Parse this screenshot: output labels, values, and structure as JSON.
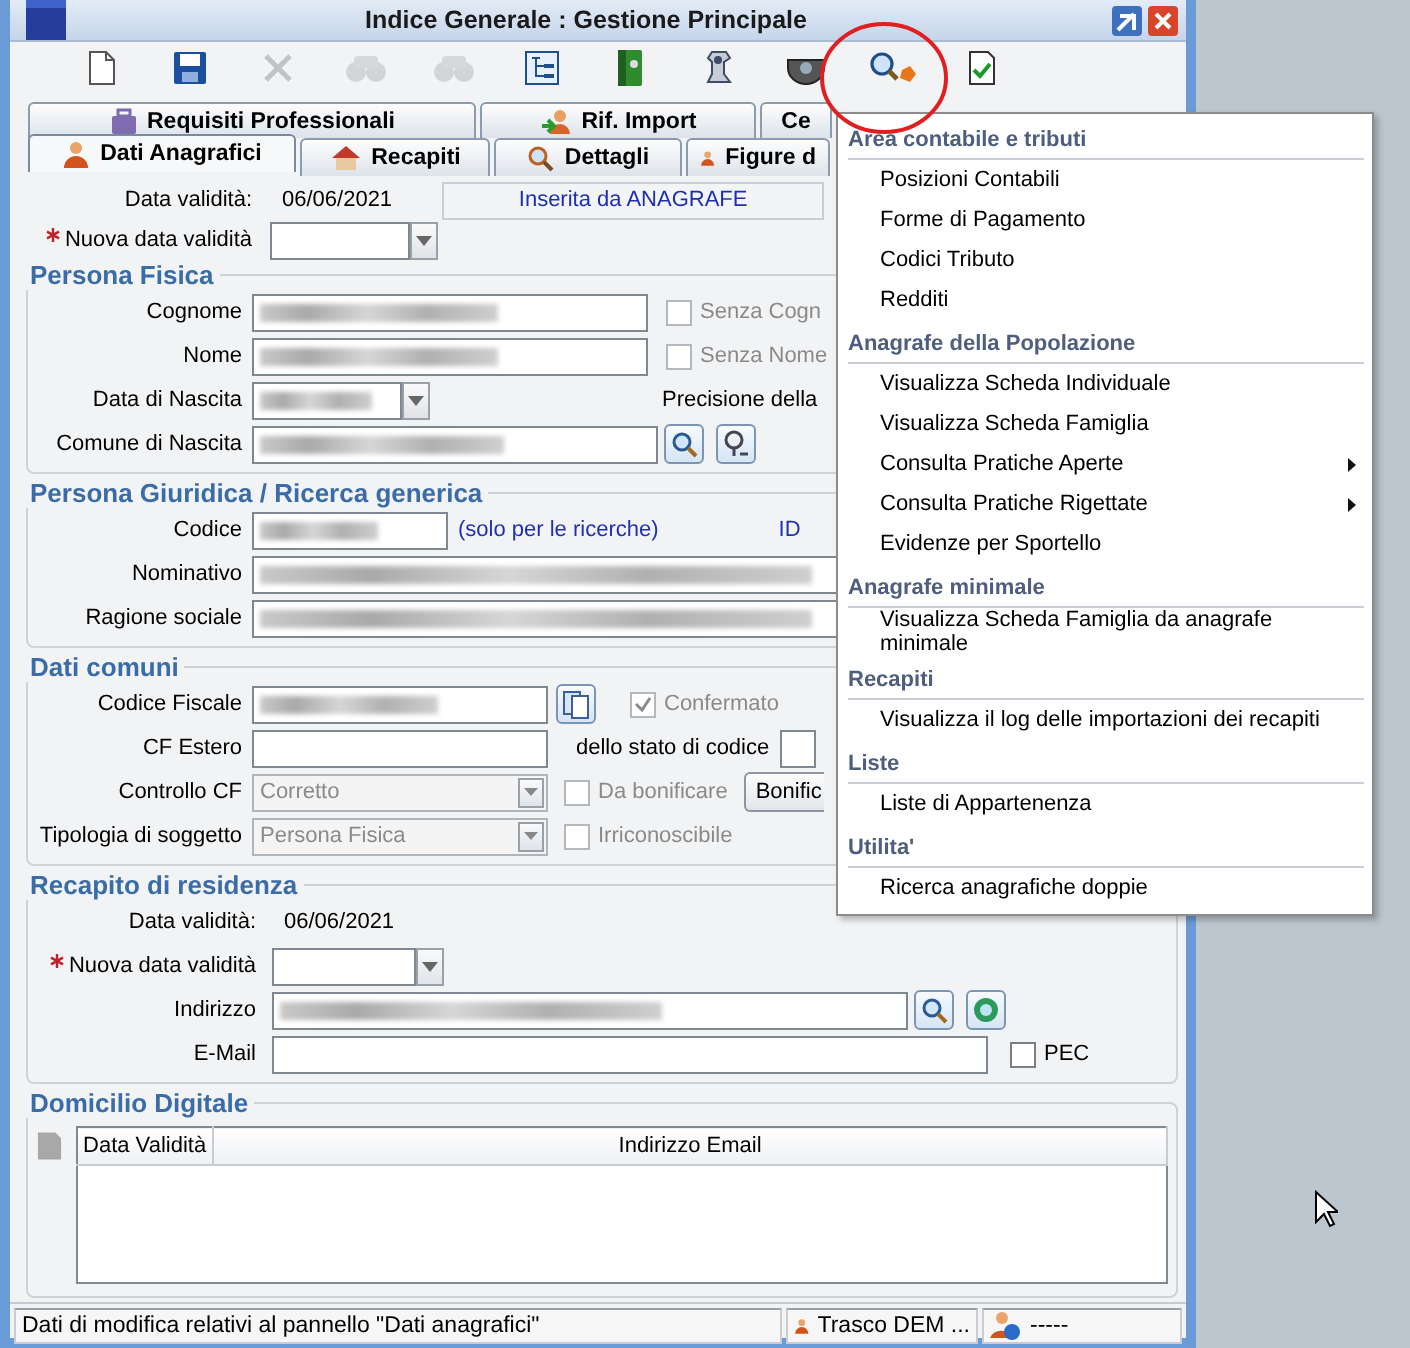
{
  "window": {
    "title": "Indice Generale : Gestione Principale"
  },
  "toolbar": [
    {
      "kind": "new",
      "disabled": false
    },
    {
      "kind": "save",
      "disabled": false
    },
    {
      "kind": "delete",
      "disabled": true
    },
    {
      "kind": "binoculars",
      "disabled": true
    },
    {
      "kind": "binoculars",
      "disabled": true
    },
    {
      "kind": "tree",
      "disabled": false
    },
    {
      "kind": "folder",
      "disabled": false
    },
    {
      "kind": "stamp",
      "disabled": false
    },
    {
      "kind": "camera",
      "disabled": false
    },
    {
      "kind": "search",
      "disabled": false
    },
    {
      "kind": "check",
      "disabled": false
    }
  ],
  "tabs": [
    [
      {
        "label": "Requisiti Professionali",
        "selected": false
      },
      {
        "label": "Rif. Import",
        "selected": false
      },
      {
        "label": "Ce",
        "selected": false
      }
    ],
    [
      {
        "label": "Dati Anagrafici",
        "selected": true
      },
      {
        "label": "Recapiti",
        "selected": false
      },
      {
        "label": "Dettagli",
        "selected": false
      },
      {
        "label": "Figure d",
        "selected": false
      }
    ]
  ],
  "form": {
    "header": {
      "validity_label": "Data validità:",
      "validity_value": "06/06/2021",
      "source": "Inserita da ANAGRAFE",
      "new_validity": {
        "label": "Nuova data validità",
        "required": true
      }
    },
    "sections": [
      {
        "title": "Persona Fisica",
        "rows": [
          {
            "label": "Cognome",
            "field": {
              "kind": "text",
              "redacted": true
            },
            "extras": [
              {
                "kind": "checkbox",
                "label": "Senza Cogn",
                "checked": false,
                "disabled": true
              }
            ]
          },
          {
            "label": "Nome",
            "field": {
              "kind": "text",
              "redacted": true
            },
            "extras": [
              {
                "kind": "checkbox",
                "label": "Senza Nome",
                "checked": false,
                "disabled": true
              }
            ]
          },
          {
            "label": "Data di Nascita",
            "field": {
              "kind": "date",
              "redacted": true
            },
            "extras": [
              {
                "kind": "label",
                "label": "Precisione della"
              }
            ]
          },
          {
            "label": "Comune di Nascita",
            "field": {
              "kind": "text",
              "redacted": true
            },
            "extras": [
              {
                "kind": "search-button"
              },
              {
                "kind": "pin-button"
              }
            ]
          }
        ]
      },
      {
        "title": "Persona Giuridica / Ricerca generica",
        "rows": [
          {
            "label": "Codice",
            "field": {
              "kind": "text",
              "redacted": true
            },
            "extras": [
              {
                "kind": "note",
                "label": "(solo per le ricerche)"
              },
              {
                "kind": "note",
                "label": "ID"
              }
            ]
          },
          {
            "label": "Nominativo",
            "field": {
              "kind": "text",
              "redacted": true
            },
            "extras": []
          },
          {
            "label": "Ragione sociale",
            "field": {
              "kind": "text",
              "redacted": true
            },
            "extras": []
          }
        ]
      },
      {
        "title": "Dati comuni",
        "rows": [
          {
            "label": "Codice Fiscale",
            "field": {
              "kind": "text",
              "redacted": true
            },
            "extras": [
              {
                "kind": "copy-button"
              },
              {
                "kind": "checkbox",
                "label": "Confermato",
                "checked": true,
                "disabled": true
              }
            ]
          },
          {
            "label": "CF Estero",
            "field": {
              "kind": "text",
              "redacted": false
            },
            "extras": [
              {
                "kind": "label",
                "label": "dello stato di codice"
              },
              {
                "kind": "field"
              }
            ]
          },
          {
            "label": "Controllo CF",
            "field": {
              "kind": "select",
              "value": "Corretto",
              "disabled": true
            },
            "extras": [
              {
                "kind": "checkbox",
                "label": "Da bonificare",
                "checked": false,
                "disabled": true
              },
              {
                "kind": "button",
                "label": "Bonific"
              }
            ]
          },
          {
            "label": "Tipologia di soggetto",
            "field": {
              "kind": "select",
              "value": "Persona Fisica",
              "disabled": true
            },
            "extras": [
              {
                "kind": "checkbox",
                "label": "Irriconoscibile",
                "checked": false,
                "disabled": true
              }
            ]
          }
        ]
      },
      {
        "title": "Recapito di residenza",
        "rows": [
          {
            "label": "Data validità:",
            "field": {
              "kind": "value",
              "value": "06/06/2021"
            },
            "extras": []
          },
          {
            "label": "Nuova data validità",
            "required": true,
            "field": {
              "kind": "date",
              "redacted": false
            },
            "extras": []
          },
          {
            "label": "Indirizzo",
            "field": {
              "kind": "text",
              "redacted": true
            },
            "extras": [
              {
                "kind": "search-button"
              },
              {
                "kind": "globe-button"
              }
            ]
          },
          {
            "label": "E-Mail",
            "field": {
              "kind": "text",
              "redacted": false
            },
            "extras": [
              {
                "kind": "checkbox",
                "label": "PEC",
                "checked": false,
                "disabled": false
              }
            ]
          }
        ]
      }
    ],
    "digital_domicile": {
      "title": "Domicilio Digitale",
      "columns": [
        "Data Validità",
        "Indirizzo Email"
      ]
    }
  },
  "status_bar": {
    "message": "Dati di modifica relativi al pannello \"Dati anagrafici\"",
    "user": "Trasco DEM ...",
    "info": "-----"
  },
  "menu": [
    {
      "title": "Area contabile e tributi",
      "items": [
        {
          "label": "Posizioni Contabili",
          "submenu": false
        },
        {
          "label": "Forme di Pagamento",
          "submenu": false
        },
        {
          "label": "Codici Tributo",
          "submenu": false
        },
        {
          "label": "Redditi",
          "submenu": false
        }
      ]
    },
    {
      "title": "Anagrafe della Popolazione",
      "items": [
        {
          "label": "Visualizza Scheda Individuale",
          "submenu": false
        },
        {
          "label": "Visualizza Scheda Famiglia",
          "submenu": false
        },
        {
          "label": "Consulta Pratiche Aperte",
          "submenu": true
        },
        {
          "label": "Consulta Pratiche Rigettate",
          "submenu": true
        },
        {
          "label": "Evidenze per Sportello",
          "submenu": false
        }
      ]
    },
    {
      "title": "Anagrafe minimale",
      "items": [
        {
          "label": "Visualizza Scheda Famiglia da anagrafe minimale",
          "submenu": false
        }
      ]
    },
    {
      "title": "Recapiti",
      "items": [
        {
          "label": "Visualizza il log delle importazioni dei recapiti",
          "submenu": false
        }
      ]
    },
    {
      "title": "Liste",
      "items": [
        {
          "label": "Liste di Appartenenza",
          "submenu": false
        }
      ]
    },
    {
      "title": "Utilita'",
      "items": [
        {
          "label": "Ricerca anagrafiche doppie",
          "submenu": false
        }
      ]
    }
  ]
}
